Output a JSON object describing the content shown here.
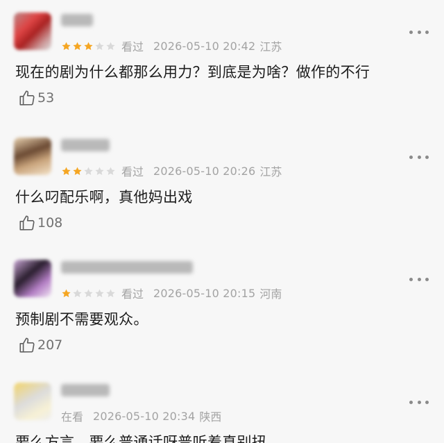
{
  "icons": {
    "more": "more-dots-icon",
    "star": "star-icon",
    "like": "thumbs-up-icon"
  },
  "colors": {
    "star_on": "#f5a623",
    "star_off": "#d9d9d9",
    "meta_text": "#a3a3a3",
    "background": "#f7f7f7"
  },
  "comments": [
    {
      "rating": 3,
      "status": "看过",
      "time": "2026-05-10 20:42",
      "location": "江苏",
      "text": "现在的剧为什么都那么用力？到底是为啥？做作的不行",
      "likes": "53"
    },
    {
      "rating": 2,
      "status": "看过",
      "time": "2026-05-10 20:26",
      "location": "江苏",
      "text": "什么叼配乐啊，真他妈出戏",
      "likes": "108"
    },
    {
      "rating": 1,
      "status": "看过",
      "time": "2026-05-10 20:15",
      "location": "河南",
      "text": "预制剧不需要观众。",
      "likes": "207"
    },
    {
      "rating": 0,
      "status": "在看",
      "time": "2026-05-10 20:34",
      "location": "陕西",
      "text": "要么方言，要么普通话呀普听着真别扭"
    }
  ]
}
